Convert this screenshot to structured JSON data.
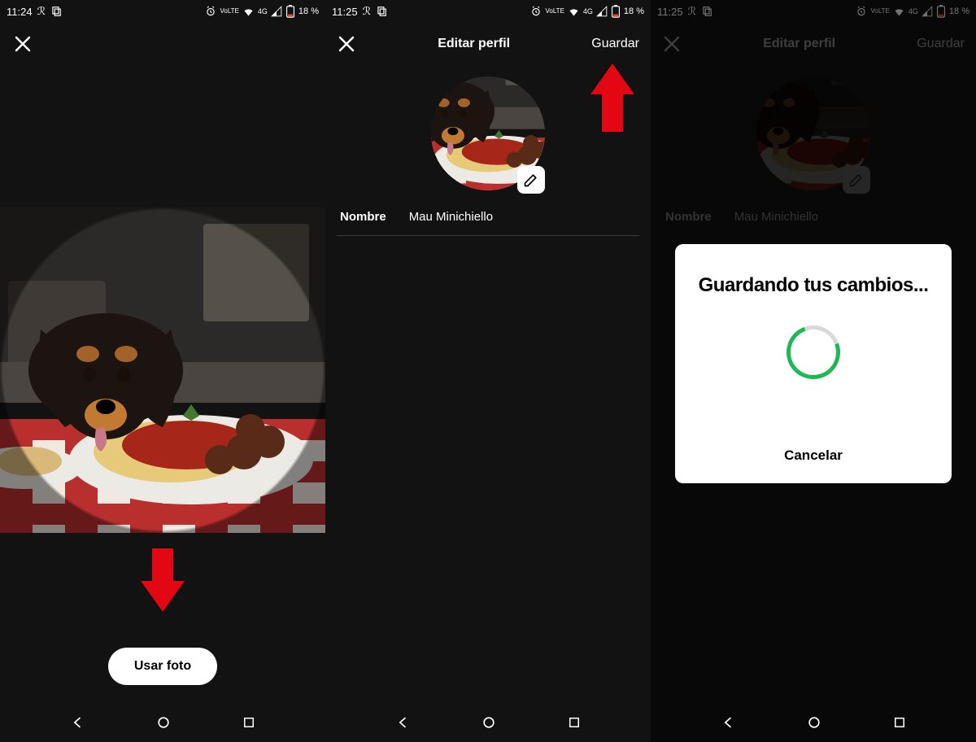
{
  "status": {
    "time_s1": "11:24",
    "time_s2": "11:25",
    "time_s3": "11:25",
    "volte": "VoLTE",
    "net": "4G",
    "battery": "18 %"
  },
  "screen1": {
    "button_use_photo": "Usar foto"
  },
  "screen2": {
    "title": "Editar perfil",
    "save": "Guardar",
    "name_label": "Nombre",
    "name_value": "Mau Minichiello"
  },
  "screen3": {
    "title": "Editar perfil",
    "save": "Guardar",
    "name_label": "Nombre",
    "name_value": "Mau Minichiello",
    "modal_title": "Guardando tus cambios...",
    "modal_cancel": "Cancelar"
  },
  "colors": {
    "spotify_green": "#1db954",
    "annotation_red": "#e30613"
  }
}
